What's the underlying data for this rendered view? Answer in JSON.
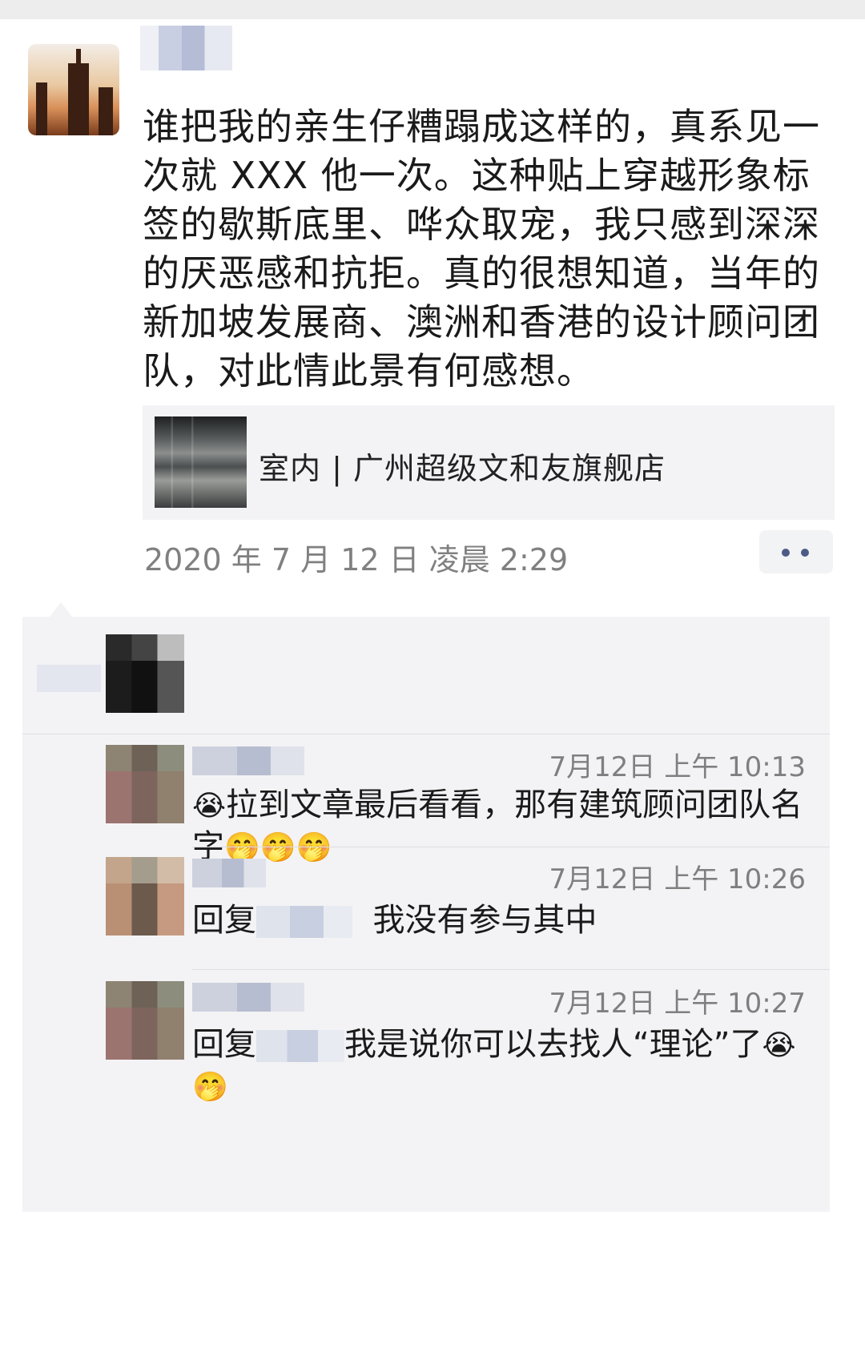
{
  "post": {
    "text": "谁把我的亲生仔糟蹋成这样的，真系见一次就 XXX 他一次。这种贴上穿越形象标签的歇斯底里、哗众取宠，我只感到深深的厌恶感和抗拒。真的很想知道，当年的新加坡发展商、澳洲和香港的设计顾问团队，对此情此景有何感想。",
    "link_title": "室内 | 广州超级文和友旗舰店",
    "time": "2020 年 7 月 12 日 凌晨 2:29"
  },
  "comments": [
    {
      "time": "7月12日 上午 10:13",
      "text": "拉到文章最后看看，那有建筑顾问团队名字",
      "lead_emoji": "😭",
      "trail_emoji": "🤭🤭🤭"
    },
    {
      "time": "7月12日 上午 10:26",
      "reply_prefix": "回复",
      "text": "我没有参与其中"
    },
    {
      "time": "7月12日 上午 10:27",
      "reply_prefix": "回复",
      "text": "我是说你可以去找人“理论”了",
      "trail_emoji": "😭🤭"
    }
  ],
  "icons": {
    "more": "more-dots-icon"
  },
  "colors": {
    "link_blue": "#4c5a86",
    "comment_bg": "#f3f3f5",
    "meta_gray": "#808080"
  }
}
